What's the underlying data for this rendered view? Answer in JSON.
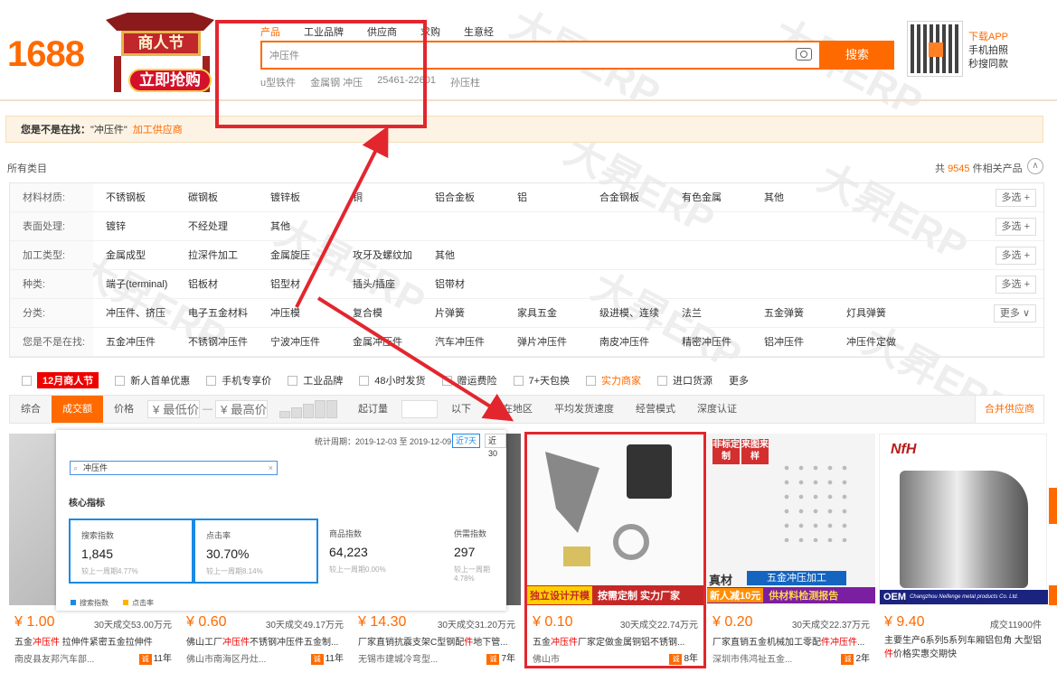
{
  "header": {
    "logo": "1688",
    "promo_title": "商人节",
    "promo_cta": "立即抢购",
    "search_tabs": [
      "产品",
      "工业品牌",
      "供应商",
      "求购",
      "生意经"
    ],
    "search_value": "冲压件",
    "search_button": "搜索",
    "hot_words": [
      "u型铁件",
      "金属钢 冲压",
      "25461-22601",
      "孙压柱"
    ],
    "app": {
      "line1": "下载APP",
      "line2": "手机拍照",
      "line3": "秒搜同款"
    }
  },
  "notice": {
    "prefix": "您是不是在找：",
    "query": "\"冲压件\"",
    "link": "加工供应商"
  },
  "filters": {
    "all_label": "所有类目",
    "count_prefix": "共",
    "count": "9545",
    "count_suffix": "件相关产品",
    "rows": [
      {
        "label": "材料材质:",
        "options": [
          "不锈钢板",
          "碳钢板",
          "镀锌板",
          "铜",
          "铝合金板",
          "铝",
          "合金钢板",
          "有色金属",
          "其他"
        ],
        "more": "多选 +"
      },
      {
        "label": "表面处理:",
        "options": [
          "镀锌",
          "不经处理",
          "其他"
        ],
        "more": "多选 +"
      },
      {
        "label": "加工类型:",
        "options": [
          "金属成型",
          "拉深件加工",
          "金属旋压",
          "攻牙及螺纹加",
          "其他"
        ],
        "more": "多选 +"
      },
      {
        "label": "种类:",
        "options": [
          "端子(terminal)",
          "铝板材",
          "铝型材",
          "插头/插座",
          "铝带材"
        ],
        "more": "多选 +"
      },
      {
        "label": "分类:",
        "options": [
          "冲压件、挤压",
          "电子五金材料",
          "冲压模",
          "复合模",
          "片弹簧",
          "家具五金",
          "级进模、连续",
          "法兰",
          "五金弹簧",
          "灯具弹簧"
        ],
        "more": "更多 ∨"
      },
      {
        "label": "您是不是在找:",
        "options": [
          "五金冲压件",
          "不锈钢冲压件",
          "宁波冲压件",
          "金属冲压件",
          "汽车冲压件",
          "弹片冲压件",
          "南皮冲压件",
          "精密冲压件",
          "铝冲压件",
          "冲压件定做"
        ],
        "more": ""
      }
    ]
  },
  "chips": {
    "promo": "12月商人节",
    "items": [
      "新人首单优惠",
      "手机专享价",
      "工业品牌",
      "48小时发货",
      "赠运费险",
      "7+天包换",
      "实力商家",
      "进口货源",
      "更多"
    ]
  },
  "sortbar": {
    "items": [
      "综合",
      "成交额",
      "价格"
    ],
    "min_price": "¥ 最低价",
    "max_price": "¥ 最高价",
    "moq": "起订量",
    "below": "以下",
    "location": "所在地区",
    "speed": "平均发货速度",
    "mode": "经营模式",
    "cert": "深度认证",
    "merge": "合并供应商"
  },
  "overlay": {
    "period_label": "统计周期：2019-12-03 至 2019-12-09",
    "btn7": "近7天",
    "btn30": "近30",
    "keyword": "冲压件",
    "header": "核心指标",
    "metrics": [
      {
        "name": "搜索指数",
        "value": "1,845",
        "cmp": "较上一周期4.77%"
      },
      {
        "name": "点击率",
        "value": "30.70%",
        "cmp": "较上一周期8.14%"
      },
      {
        "name": "商品指数",
        "value": "64,223",
        "cmp": "较上一周期0.00%"
      },
      {
        "name": "供需指数",
        "value": "297",
        "cmp": "较上一周期4.78%"
      }
    ],
    "legend1": "搜索指数",
    "legend2": "点击率"
  },
  "products": [
    {
      "price": "¥ 1.00",
      "sold": "30天成交53.00万元",
      "title_pre": "五金",
      "title_hl": "冲压件",
      "title_post": " 拉伸件紧密五金拉伸件",
      "seller": "南皮县友邦汽车部...",
      "years": "11年"
    },
    {
      "price": "¥ 0.60",
      "sold": "30天成交49.17万元",
      "title_pre": "佛山工厂",
      "title_hl": "冲压件",
      "title_post": "不锈钢冲压件五金制...",
      "seller": "佛山市南海区丹灶...",
      "years": "11年"
    },
    {
      "price": "¥ 14.30",
      "sold": "30天成交31.20万元",
      "title_pre": "厂家直销抗震支架C型钢配",
      "title_hl": "件",
      "title_post": "地下管...",
      "seller": "无锡市建城冷弯型...",
      "years": "7年"
    },
    {
      "price": "¥ 0.10",
      "sold": "30天成交22.74万元",
      "title_pre": "五金",
      "title_hl": "冲压件",
      "title_post": "厂家定做金属铜铝不锈钢...",
      "seller": "佛山市",
      "years": "8年",
      "tag1": "独立设计开模",
      "tag2": "按需定制 实力厂家"
    },
    {
      "price": "¥ 0.20",
      "sold": "30天成交22.37万元",
      "title_pre": "厂家直销五金机械加工零配",
      "title_hl": "件冲压件",
      "title_post": "...",
      "seller": "深圳市伟鸿祉五金...",
      "years": "2年",
      "tag1": "非标定制",
      "tag2": "来图来样",
      "tag3": "真材",
      "tag4": "五金冲压加工",
      "tag5": "新人减10元",
      "tag6": "供材料检测报告"
    },
    {
      "price": "¥ 9.40",
      "sold": "成交11900件",
      "title_pre": "主要生产6系列5系列车厢铝包角 大型铝",
      "title_hl": "件",
      "title_post": "价格实惠交期快",
      "seller": "",
      "years": "",
      "brand": "OEM",
      "brand_sub": "Changzhou Neifenge metal products Co. Ltd."
    }
  ],
  "colors": {
    "accent": "#ff6a00",
    "annotation": "#e3262e",
    "selected": "#1a8ae5"
  }
}
